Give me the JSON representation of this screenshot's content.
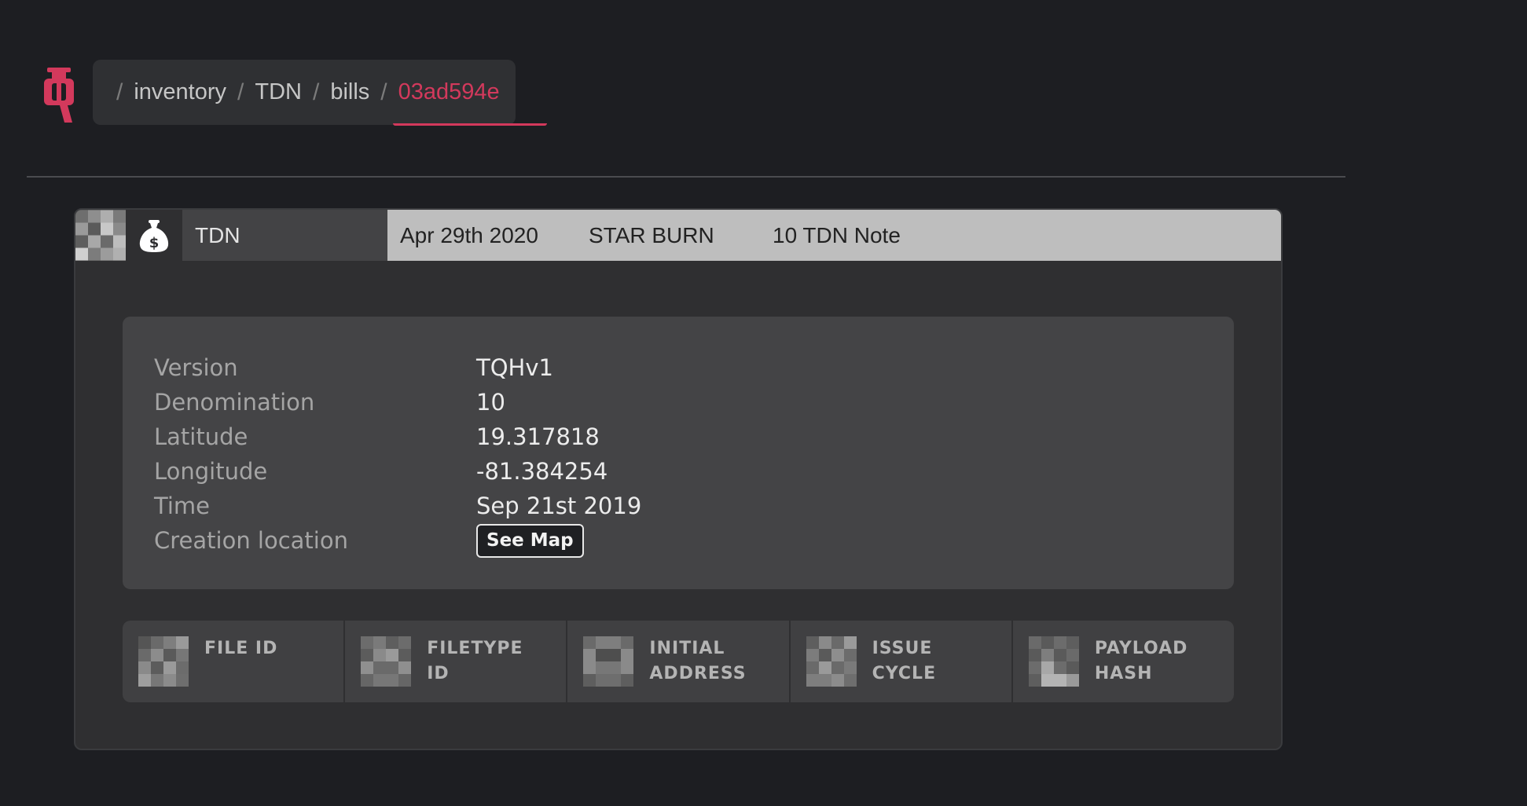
{
  "colors": {
    "accent": "#d3395c",
    "background": "#1d1e22",
    "card": "#2f2f31",
    "meta_bar": "#bebebe"
  },
  "logo_icon": "tq-logo-icon",
  "breadcrumb": {
    "items": [
      "inventory",
      "TDN",
      "bills"
    ],
    "active": "03ad594e",
    "separator": "/"
  },
  "bill": {
    "currency": "TDN",
    "currency_icon": "money-bag-icon",
    "date": "Apr 29th 2020",
    "event": "STAR BURN",
    "note": "10 TDN Note"
  },
  "details": [
    {
      "label": "Version",
      "value": "TQHv1"
    },
    {
      "label": "Denomination",
      "value": "10"
    },
    {
      "label": "Latitude",
      "value": "19.317818"
    },
    {
      "label": "Longitude",
      "value": "-81.384254"
    },
    {
      "label": "Time",
      "value": "Sep 21st 2019"
    },
    {
      "label": "Creation location",
      "value": ""
    }
  ],
  "see_map_label": "See Map",
  "tiles": [
    {
      "label": "FILE ID"
    },
    {
      "label": "FILETYPE ID"
    },
    {
      "label": "INITIAL ADDRESS"
    },
    {
      "label": "ISSUE CYCLE"
    },
    {
      "label": "PAYLOAD HASH"
    }
  ]
}
